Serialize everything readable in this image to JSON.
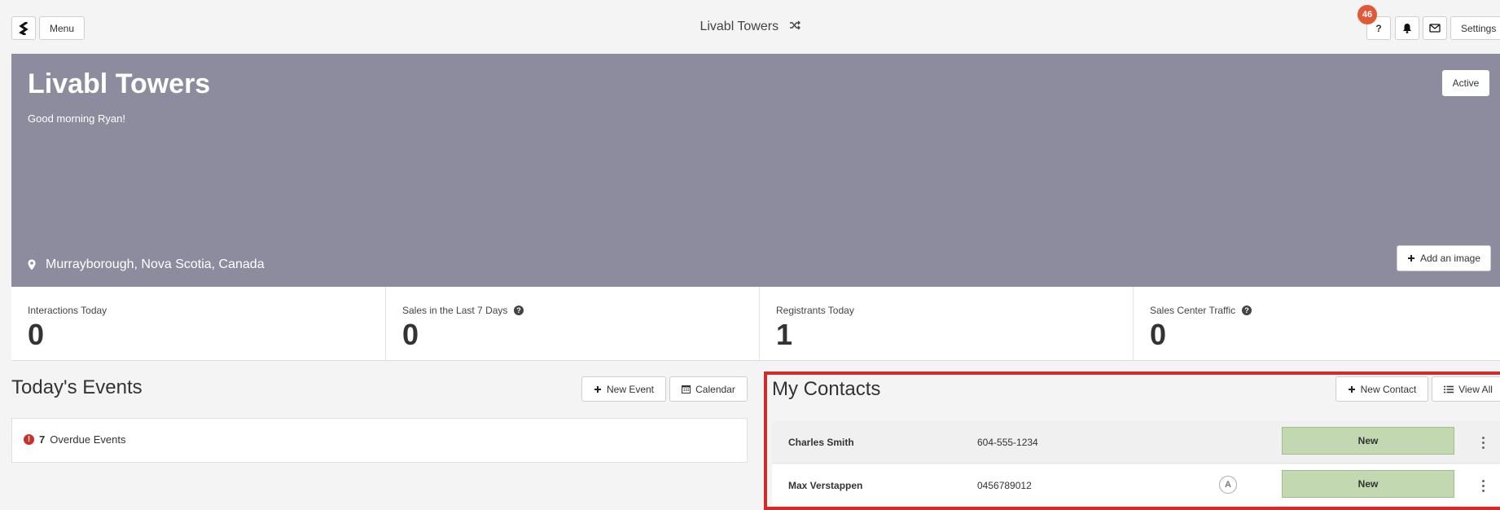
{
  "topbar": {
    "menu_label": "Menu",
    "project_name": "Livabl Towers",
    "notification_count": "46",
    "help_label": "?",
    "settings_label": "Settings"
  },
  "hero": {
    "title": "Livabl Towers",
    "greeting": "Good morning Ryan!",
    "status_label": "Active",
    "location": "Murrayborough, Nova Scotia, Canada",
    "add_image_label": "Add an image",
    "background_color": "#8c8c9e"
  },
  "stats": [
    {
      "label": "Interactions Today",
      "value": "0"
    },
    {
      "label": "Sales in the Last 7 Days",
      "value": "0"
    },
    {
      "label": "Registrants Today",
      "value": "1"
    },
    {
      "label": "Sales Center Traffic",
      "value": "0"
    }
  ],
  "events": {
    "title": "Today's Events",
    "new_event_label": "New Event",
    "calendar_label": "Calendar",
    "overdue_count": "7",
    "overdue_label": "Overdue Events"
  },
  "contacts": {
    "title": "My Contacts",
    "new_contact_label": "New Contact",
    "view_all_label": "View All",
    "highlight_color": "#d32a2a",
    "rows": [
      {
        "name": "Charles Smith",
        "phone": "604-555-1234",
        "avatar": "",
        "status": "New"
      },
      {
        "name": "Max Verstappen",
        "phone": "0456789012",
        "avatar": "A",
        "status": "New"
      }
    ]
  },
  "icons": {
    "logo": "livabl-logo-icon",
    "shuffle": "shuffle-icon",
    "bell": "bell-icon",
    "mail": "envelope-icon",
    "pin": "map-pin-icon",
    "plus": "plus-icon",
    "calendar": "calendar-icon",
    "list": "list-icon",
    "info": "question-circle-icon",
    "overdue": "exclamation-circle-icon",
    "more": "vertical-dots-icon"
  }
}
